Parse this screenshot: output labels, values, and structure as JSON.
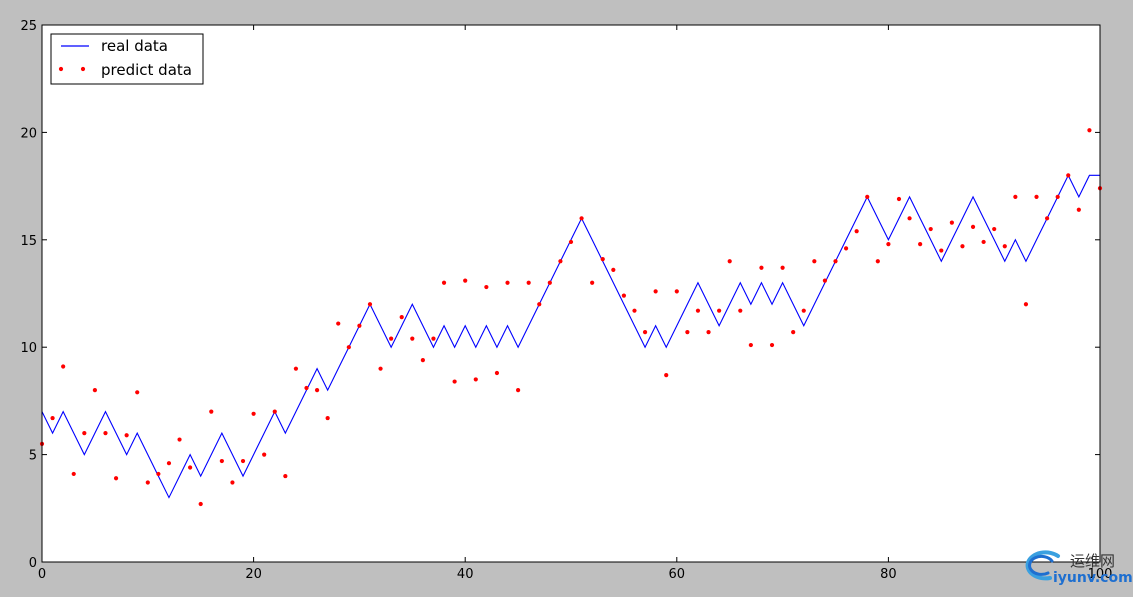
{
  "chart_data": {
    "type": "line",
    "title": "",
    "xlabel": "",
    "ylabel": "",
    "xlim": [
      0,
      100
    ],
    "ylim": [
      0,
      25
    ],
    "xticks": [
      0,
      20,
      40,
      60,
      80,
      100
    ],
    "yticks": [
      0,
      5,
      10,
      15,
      20,
      25
    ],
    "grid": false,
    "legend_position": "top-left",
    "series": [
      {
        "name": "real data",
        "style": "line",
        "color": "#0000ff",
        "x": [
          0,
          1,
          2,
          3,
          4,
          5,
          6,
          7,
          8,
          9,
          10,
          11,
          12,
          13,
          14,
          15,
          16,
          17,
          18,
          19,
          20,
          21,
          22,
          23,
          24,
          25,
          26,
          27,
          28,
          29,
          30,
          31,
          32,
          33,
          34,
          35,
          36,
          37,
          38,
          39,
          40,
          41,
          42,
          43,
          44,
          45,
          46,
          47,
          48,
          49,
          50,
          51,
          52,
          53,
          54,
          55,
          56,
          57,
          58,
          59,
          60,
          61,
          62,
          63,
          64,
          65,
          66,
          67,
          68,
          69,
          70,
          71,
          72,
          73,
          74,
          75,
          76,
          77,
          78,
          79,
          80,
          81,
          82,
          83,
          84,
          85,
          86,
          87,
          88,
          89,
          90,
          91,
          92,
          93,
          94,
          95,
          96,
          97,
          98,
          99,
          100
        ],
        "y": [
          7,
          6,
          7,
          6,
          5,
          6,
          7,
          6,
          5,
          6,
          5,
          4,
          3,
          4,
          5,
          4,
          5,
          6,
          5,
          4,
          5,
          6,
          7,
          6,
          7,
          8,
          9,
          8,
          9,
          10,
          11,
          12,
          11,
          10,
          11,
          12,
          11,
          10,
          11,
          10,
          11,
          10,
          11,
          10,
          11,
          10,
          11,
          12,
          13,
          14,
          15,
          16,
          15,
          14,
          13,
          12,
          11,
          10,
          11,
          10,
          11,
          12,
          13,
          12,
          11,
          12,
          13,
          12,
          13,
          12,
          13,
          12,
          11,
          12,
          13,
          14,
          15,
          16,
          17,
          16,
          15,
          16,
          17,
          16,
          15,
          14,
          15,
          16,
          17,
          16,
          15,
          14,
          15,
          14,
          15,
          16,
          17,
          18,
          17,
          18,
          18
        ]
      },
      {
        "name": "predict data",
        "style": "scatter",
        "color": "#ff0000",
        "x": [
          0,
          1,
          2,
          3,
          4,
          5,
          6,
          7,
          8,
          9,
          10,
          11,
          12,
          13,
          14,
          15,
          16,
          17,
          18,
          19,
          20,
          21,
          22,
          23,
          24,
          25,
          26,
          27,
          28,
          29,
          30,
          31,
          32,
          33,
          34,
          35,
          36,
          37,
          38,
          39,
          40,
          41,
          42,
          43,
          44,
          45,
          46,
          47,
          48,
          49,
          50,
          51,
          52,
          53,
          54,
          55,
          56,
          57,
          58,
          59,
          60,
          61,
          62,
          63,
          64,
          65,
          66,
          67,
          68,
          69,
          70,
          71,
          72,
          73,
          74,
          75,
          76,
          77,
          78,
          79,
          80,
          81,
          82,
          83,
          84,
          85,
          86,
          87,
          88,
          89,
          90,
          91,
          92,
          93,
          94,
          95,
          96,
          97,
          98,
          99,
          100
        ],
        "y": [
          5.5,
          6.7,
          9.1,
          4.1,
          6.0,
          8.0,
          6.0,
          3.9,
          5.9,
          7.9,
          3.7,
          4.1,
          4.6,
          5.7,
          4.4,
          2.7,
          7.0,
          4.7,
          3.7,
          4.7,
          6.9,
          5.0,
          7.0,
          4.0,
          9.0,
          8.1,
          8.0,
          6.7,
          11.1,
          10.0,
          11.0,
          12.0,
          9.0,
          10.4,
          11.4,
          10.4,
          9.4,
          10.4,
          13.0,
          8.4,
          13.1,
          8.5,
          12.8,
          8.8,
          13.0,
          8.0,
          13.0,
          12.0,
          13.0,
          14.0,
          14.9,
          16.0,
          13.0,
          14.1,
          13.6,
          12.4,
          11.7,
          10.7,
          12.6,
          8.7,
          12.6,
          10.7,
          11.7,
          10.7,
          11.7,
          14.0,
          11.7,
          10.1,
          13.7,
          10.1,
          13.7,
          10.7,
          11.7,
          14.0,
          13.1,
          14.0,
          14.6,
          15.4,
          17.0,
          14.0,
          14.8,
          16.9,
          16.0,
          14.8,
          15.5,
          14.5,
          15.8,
          14.7,
          15.6,
          14.9,
          15.5,
          14.7,
          17.0,
          12.0,
          17.0,
          16.0,
          17.0,
          18.0,
          16.4,
          20.1,
          17.4
        ]
      }
    ]
  },
  "watermark": {
    "cn_text": "运维网",
    "domain_text": "iyunv.com",
    "color": "#1e6fd0",
    "icon": "swirl-logo-icon"
  }
}
